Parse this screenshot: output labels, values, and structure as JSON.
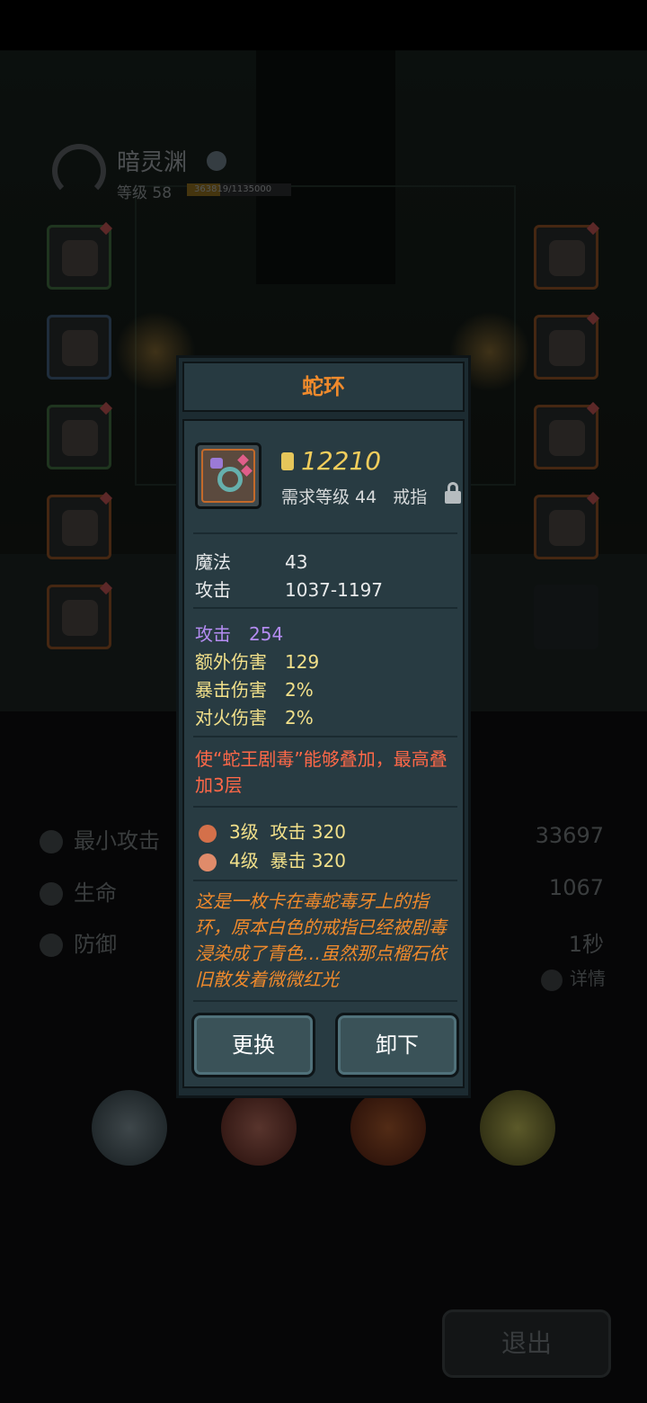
{
  "hero": {
    "name": "暗灵渊",
    "level_text": "等级 58",
    "xp_text": "363819/1135000",
    "xp_progress": 0.32
  },
  "stats": [
    {
      "label": "最小攻击",
      "value": "33697",
      "icon": "sword-icon"
    },
    {
      "label": "生命",
      "value": "1067",
      "icon": "heart-icon"
    },
    {
      "label": "防御",
      "value": "1秒",
      "icon": "shield-icon"
    }
  ],
  "details_label": "详情",
  "exit_label": "退出",
  "item": {
    "name": "蛇环",
    "power": "12210",
    "required_level": "需求等级 44",
    "type": "戒指",
    "base_stats": [
      {
        "label": "魔法",
        "value": "43"
      },
      {
        "label": "攻击",
        "value": "1037-1197"
      }
    ],
    "extra_stats": [
      {
        "label": "攻击",
        "value": "254",
        "color": "#b48cf2"
      },
      {
        "label": "额外伤害",
        "value": "129",
        "color": "#f2e08a"
      },
      {
        "label": "暴击伤害",
        "value": "2%",
        "color": "#f2e08a"
      },
      {
        "label": "对火伤害",
        "value": "2%",
        "color": "#f2e08a"
      }
    ],
    "special_effect": "使“蛇王剧毒”能够叠加，最高叠加3层",
    "set_bonuses": [
      {
        "level": "3级",
        "bonus": "攻击 320"
      },
      {
        "level": "4级",
        "bonus": "暴击 320"
      }
    ],
    "lore": "这是一枚卡在毒蛇毒牙上的指环，原本白色的戒指已经被剧毒浸染成了青色…虽然那点榴石依旧散发着微微红光",
    "buttons": {
      "replace": "更换",
      "unequip": "卸下"
    }
  },
  "colors": {
    "title_orange": "#f08a2c",
    "power_gold": "#f2cd5c",
    "purple_stat": "#b48cf2",
    "effect_red": "#ff6848",
    "panel_bg": "#283b42"
  }
}
